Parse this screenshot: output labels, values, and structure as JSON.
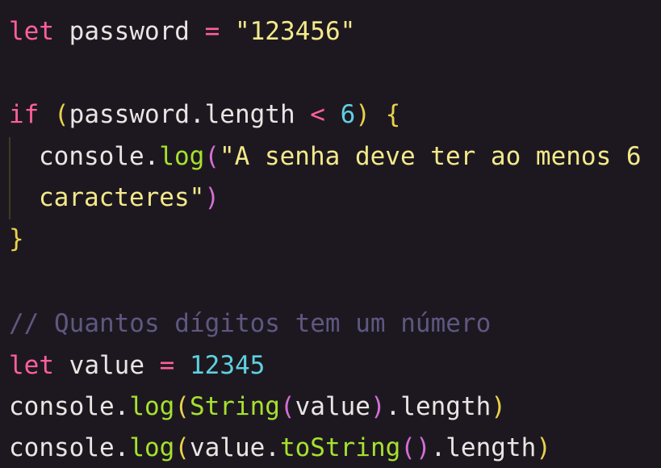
{
  "code": {
    "line1": {
      "kw": "let",
      "name": " password ",
      "op": "=",
      "str": " \"123456\""
    },
    "line2": {
      "kw": "if",
      "sp": " ",
      "open": "(",
      "expr": "password.length ",
      "op": "<",
      "num": " 6",
      "close": ")",
      "brace": " {"
    },
    "line3": {
      "obj": "console.",
      "fn": "log",
      "open": "(",
      "str": "\"A senha deve ter ao menos 6"
    },
    "line4": {
      "str": "caracteres\"",
      "close": ")"
    },
    "line5": {
      "brace": "}"
    },
    "line6": {
      "comment": "// Quantos dígitos tem um número"
    },
    "line7": {
      "kw": "let",
      "name": " value ",
      "op": "=",
      "num": " 12345"
    },
    "line8": {
      "obj": "console.",
      "fn": "log",
      "open": "(",
      "cls": "String",
      "open2": "(",
      "arg": "value",
      "close2": ")",
      "prop": ".length",
      "close": ")"
    },
    "line9": {
      "obj": "console.",
      "fn": "log",
      "open": "(",
      "arg": "value.",
      "method": "toString",
      "call": "()",
      "prop": ".length",
      "close": ")"
    }
  },
  "colors": {
    "background": "#1d1820",
    "keyword": "#ff5f9e",
    "string": "#f3e98a",
    "number": "#5fd0e0",
    "function": "#a6e22e",
    "comment": "#5e5880"
  }
}
